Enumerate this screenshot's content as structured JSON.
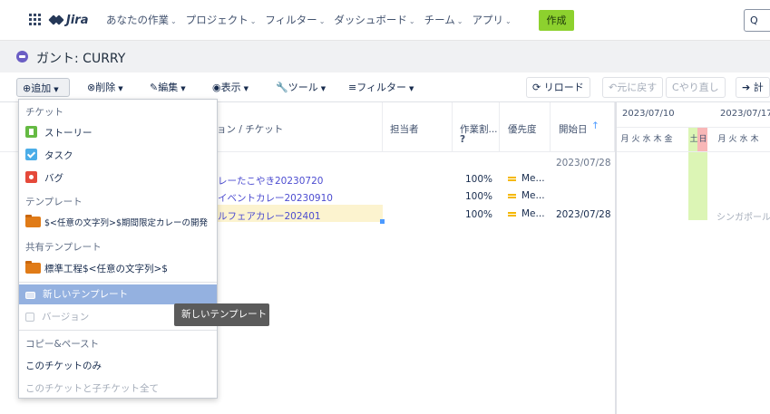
{
  "nav": {
    "product": "Jira",
    "items": [
      {
        "label": "あなたの作業"
      },
      {
        "label": "プロジェクト"
      },
      {
        "label": "フィルター"
      },
      {
        "label": "ダッシュボード"
      },
      {
        "label": "チーム"
      },
      {
        "label": "アプリ"
      }
    ],
    "chevron": "⌄",
    "create_label": "作成",
    "search_placeholder": "Q",
    "accent_color": "#8dd12e"
  },
  "page": {
    "title": "ガント: CURRY"
  },
  "toolbar": {
    "add": "追加",
    "delete": "削除",
    "edit": "編集",
    "view": "表示",
    "tools": "ツール",
    "filter": "フィルター",
    "reload": "リロード",
    "undo": "元に戻す",
    "redo": "やり直し",
    "plan": "計"
  },
  "table": {
    "headers": {
      "summary": "ョン / チケット",
      "assignee": "担当者",
      "progress": "作業割...",
      "progress_help": "?",
      "priority": "優先度",
      "start": "開始日",
      "sort_indicator": "↑"
    },
    "top_date": "2023/07/28",
    "rows": [
      {
        "summary": "レーたこやき20230720",
        "progress": "100%",
        "priority": "Me...",
        "start": ""
      },
      {
        "summary": "イベントカレー20230910",
        "progress": "100%",
        "priority": "Me...",
        "start": ""
      },
      {
        "summary": "ルフェアカレー202401",
        "progress": "100%",
        "priority": "Me...",
        "start": "2023/07/28"
      }
    ]
  },
  "gantt": {
    "weeks": [
      "2023/07/10",
      "2023/07/17"
    ],
    "days": [
      "月",
      "火",
      "水",
      "木",
      "金",
      "土",
      "日",
      "月",
      "火",
      "水",
      "木"
    ],
    "bar_label": "シンガポール"
  },
  "menu": {
    "section_ticket": "チケット",
    "story": "ストーリー",
    "task": "タスク",
    "bug": "バグ",
    "section_template": "テンプレート",
    "template_item": "$<任意の文字列>$期間限定カレーの開発",
    "section_shared": "共有テンプレート",
    "shared_item": "標準工程$<任意の文字列>$",
    "new_template": "新しいテンプレート",
    "version": "バージョン",
    "section_copy": "コピー&ペースト",
    "this_ticket": "このチケットのみ",
    "with_children": "このチケットと子チケット全て"
  },
  "tooltip": {
    "text": "新しいテンプレート"
  }
}
